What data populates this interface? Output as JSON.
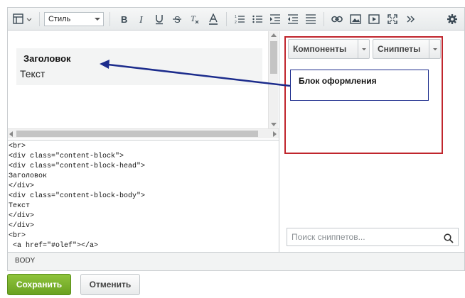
{
  "toolbar": {
    "style_select": "Стиль",
    "tools": [
      "template-icon",
      "bold-icon",
      "italic-icon",
      "underline-icon",
      "strikethrough-icon",
      "clear-format-icon",
      "font-color-icon",
      "ordered-list-icon",
      "unordered-list-icon",
      "indent-icon",
      "outdent-icon",
      "align-icon",
      "link-icon",
      "image-icon",
      "video-icon",
      "fullscreen-icon",
      "more-icon",
      "settings-icon"
    ]
  },
  "visual": {
    "head": "Заголовок",
    "body": "Текст"
  },
  "code_lines": [
    "<br>",
    "<div class=\"content-block\">",
    "<div class=\"content-block-head\">",
    "Заголовок",
    "</div>",
    "<div class=\"content-block-body\">",
    "Текст",
    "</div>",
    "</div>",
    "<br>",
    " <a href=\"#olef\"></a>"
  ],
  "panel": {
    "components_label": "Компоненты",
    "snippets_label": "Сниппеты",
    "search_placeholder": "Поиск сниппетов..."
  },
  "callout": "Блок оформления",
  "status_path": "BODY",
  "actions": {
    "save": "Сохранить",
    "cancel": "Отменить"
  },
  "colors": {
    "save_button": "#7ab22e",
    "red_frame": "#c0262d",
    "arrow": "#1c2c8c"
  }
}
